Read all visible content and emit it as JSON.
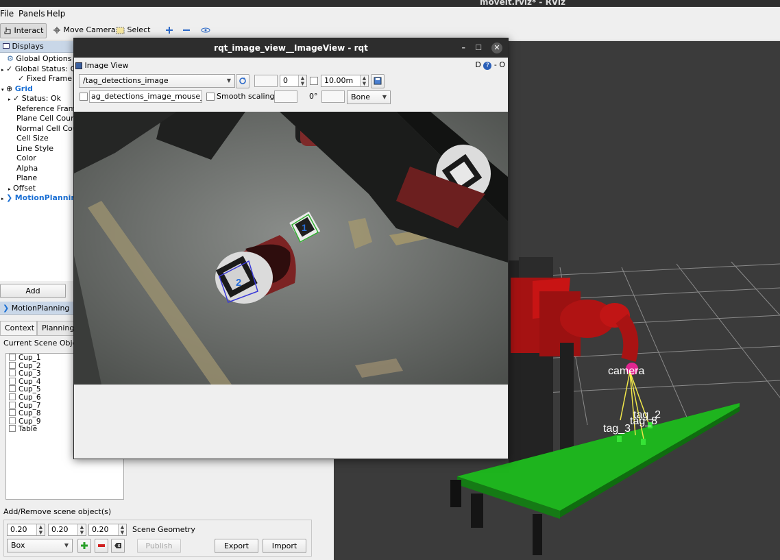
{
  "os_title": "moveit.rviz* - RViz",
  "menubar": {
    "file": "File",
    "panels": "Panels",
    "help": "Help"
  },
  "toolbar": {
    "interact": "Interact",
    "move_camera": "Move Camera",
    "select": "Select"
  },
  "displays": {
    "title": "Displays",
    "items": [
      {
        "label": "Global Options"
      },
      {
        "label": "Global Status: Ok"
      },
      {
        "label": "Fixed Frame"
      },
      {
        "label": "Grid"
      },
      {
        "label": "Status: Ok"
      },
      {
        "label": "Reference Frame"
      },
      {
        "label": "Plane Cell Count"
      },
      {
        "label": "Normal Cell Count"
      },
      {
        "label": "Cell Size"
      },
      {
        "label": "Line Style"
      },
      {
        "label": "Color"
      },
      {
        "label": "Alpha"
      },
      {
        "label": "Plane"
      },
      {
        "label": "Offset"
      },
      {
        "label": "MotionPlanning"
      }
    ],
    "add_button": "Add"
  },
  "motion_planning": {
    "title": "MotionPlanning",
    "tabs": [
      "Context",
      "Planning"
    ],
    "current_scene_objects": "Current Scene Objects",
    "objects": [
      "Cup_1",
      "Cup_2",
      "Cup_3",
      "Cup_4",
      "Cup_5",
      "Cup_6",
      "Cup_7",
      "Cup_8",
      "Cup_9",
      "Table"
    ],
    "add_remove_label": "Add/Remove scene object(s)",
    "dims": [
      "0.20",
      "0.20",
      "0.20"
    ],
    "scene_geometry": "Scene Geometry",
    "shape": "Box",
    "publish": "Publish",
    "export": "Export",
    "import": "Import"
  },
  "rqt": {
    "window_title": "rqt_image_view__ImageView - rqt",
    "plugin_title": "Image View",
    "plugin_controls": "D",
    "plugin_dash": "- O",
    "topic": "/tag_detections_image",
    "spin_value": "0",
    "max_range": "10.00m",
    "mouse_topic": "ag_detections_image_mouse_left",
    "smooth_scaling": "Smooth scaling",
    "rotation": "0°",
    "colormap": "Bone",
    "tag_labels": [
      "1",
      "2"
    ]
  },
  "view3d": {
    "frame_labels": [
      "camera",
      "tag_3",
      "tag_2",
      "tag_8"
    ]
  },
  "colors": {
    "title_bar": "#2d2d2d",
    "panel_header": "#c9d7e8",
    "view_bg": "#3b3b3b",
    "table_green": "#1eb41e",
    "robot_red": "#b41010",
    "tf_line": "#f0e64a"
  }
}
